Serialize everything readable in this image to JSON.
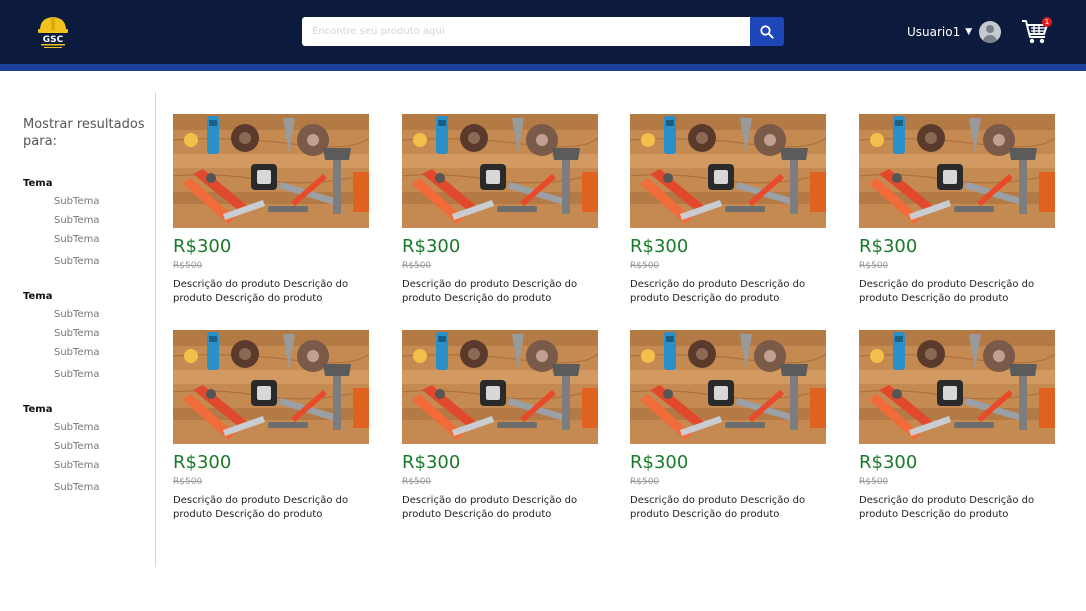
{
  "header": {
    "logo_text": "GSC",
    "search_placeholder": "Encontre seu produto aqui",
    "user_name": "Usuario1",
    "cart_count": "1"
  },
  "sidebar": {
    "title": "Mostrar resultados para:",
    "groups": [
      {
        "title": "Tema",
        "items": [
          "SubTema",
          "SubTema",
          "SubTema",
          "SubTema"
        ]
      },
      {
        "title": "Tema",
        "items": [
          "SubTema",
          "SubTema",
          "SubTema",
          "SubTema"
        ]
      },
      {
        "title": "Tema",
        "items": [
          "SubTema",
          "SubTema",
          "SubTema",
          "SubTema"
        ]
      }
    ]
  },
  "products": [
    {
      "price": "R$300",
      "old_price": "R$500",
      "description": "Descrição do produto Descrição do produto Descrição do produto"
    },
    {
      "price": "R$300",
      "old_price": "R$500",
      "description": "Descrição do produto Descrição do produto Descrição do produto"
    },
    {
      "price": "R$300",
      "old_price": "R$500",
      "description": "Descrição do produto Descrição do produto Descrição do produto"
    },
    {
      "price": "R$300",
      "old_price": "R$500",
      "description": "Descrição do produto Descrição do produto Descrição do produto"
    },
    {
      "price": "R$300",
      "old_price": "R$500",
      "description": "Descrição do produto Descrição do produto Descrição do produto"
    },
    {
      "price": "R$300",
      "old_price": "R$500",
      "description": "Descrição do produto Descrição do produto Descrição do produto"
    },
    {
      "price": "R$300",
      "old_price": "R$500",
      "description": "Descrição do produto Descrição do produto Descrição do produto"
    },
    {
      "price": "R$300",
      "old_price": "R$500",
      "description": "Descrição do produto Descrição do produto Descrição do produto"
    }
  ],
  "colors": {
    "header_bg": "#0c1a3e",
    "accent_blue": "#1d3f9c",
    "price_green": "#1a7a2a",
    "badge_red": "#e21b1b"
  },
  "icons": {
    "logo": "hard-hat-logo",
    "search": "search-icon",
    "user": "user-avatar-icon",
    "cart": "shopping-cart-icon"
  }
}
